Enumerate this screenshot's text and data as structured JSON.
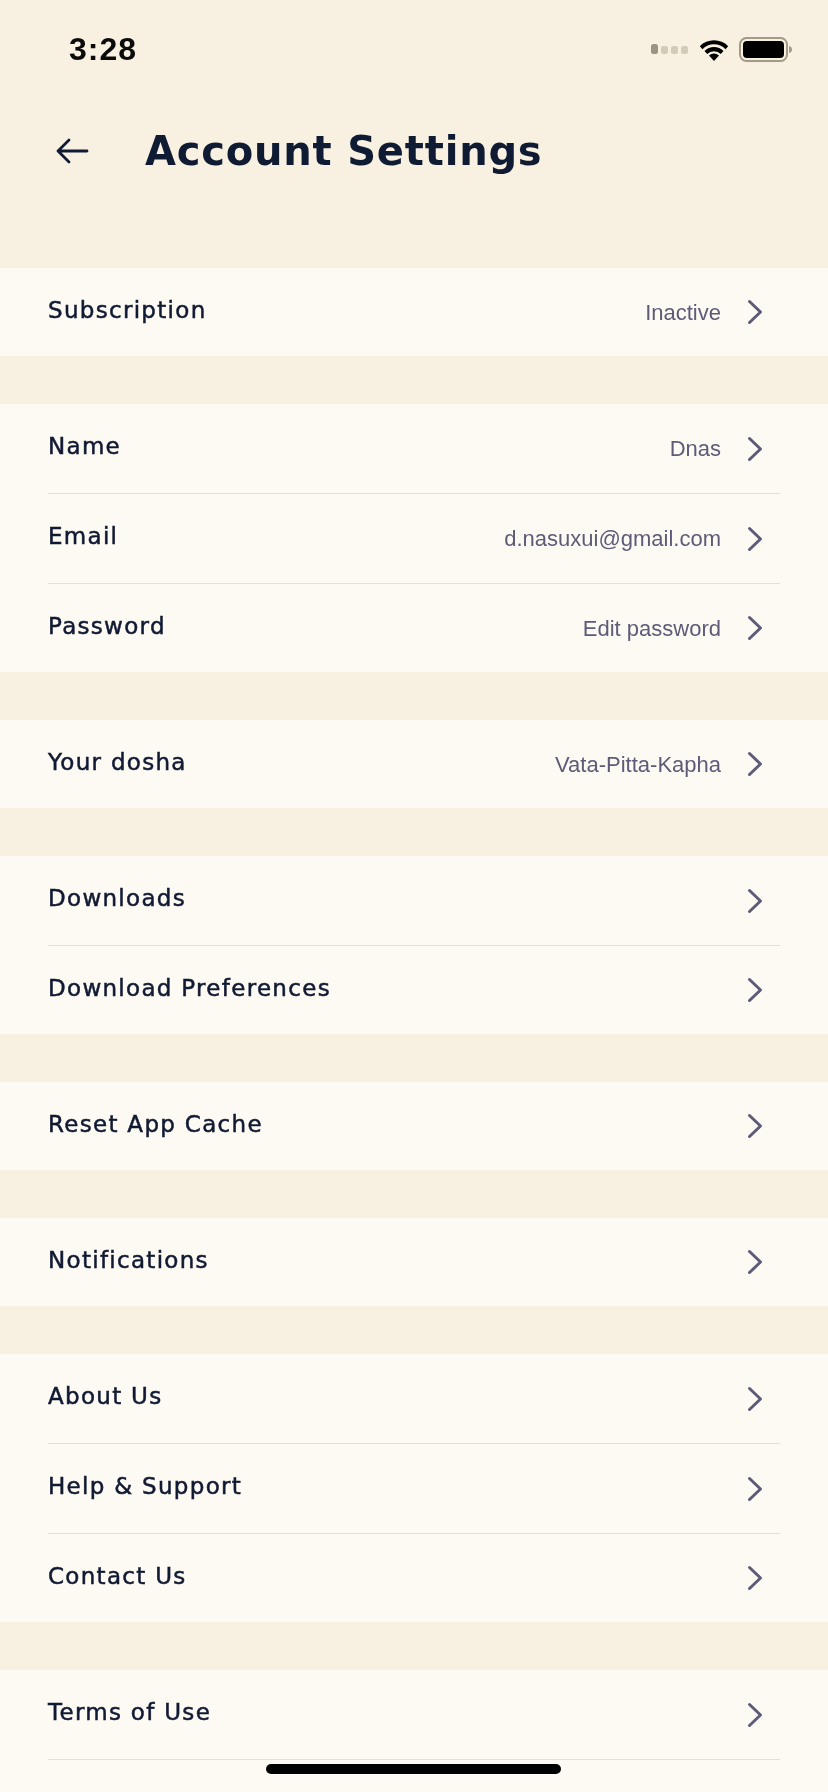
{
  "status_bar": {
    "time": "3:28"
  },
  "header": {
    "title": "Account Settings"
  },
  "sections": [
    {
      "items": [
        {
          "label": "Subscription",
          "value": "Inactive"
        }
      ]
    },
    {
      "items": [
        {
          "label": "Name",
          "value": "Dnas"
        },
        {
          "label": "Email",
          "value": "d.nasuxui@gmail.com"
        },
        {
          "label": "Password",
          "value": "Edit password"
        }
      ]
    },
    {
      "items": [
        {
          "label": "Your dosha",
          "value": "Vata-Pitta-Kapha"
        }
      ]
    },
    {
      "items": [
        {
          "label": "Downloads"
        },
        {
          "label": "Download Preferences"
        }
      ]
    },
    {
      "items": [
        {
          "label": "Reset App Cache"
        }
      ]
    },
    {
      "items": [
        {
          "label": "Notifications"
        }
      ]
    },
    {
      "items": [
        {
          "label": "About Us"
        },
        {
          "label": "Help & Support"
        },
        {
          "label": "Contact Us"
        }
      ]
    },
    {
      "items": [
        {
          "label": "Terms of Use"
        }
      ],
      "more_below": true
    }
  ]
}
